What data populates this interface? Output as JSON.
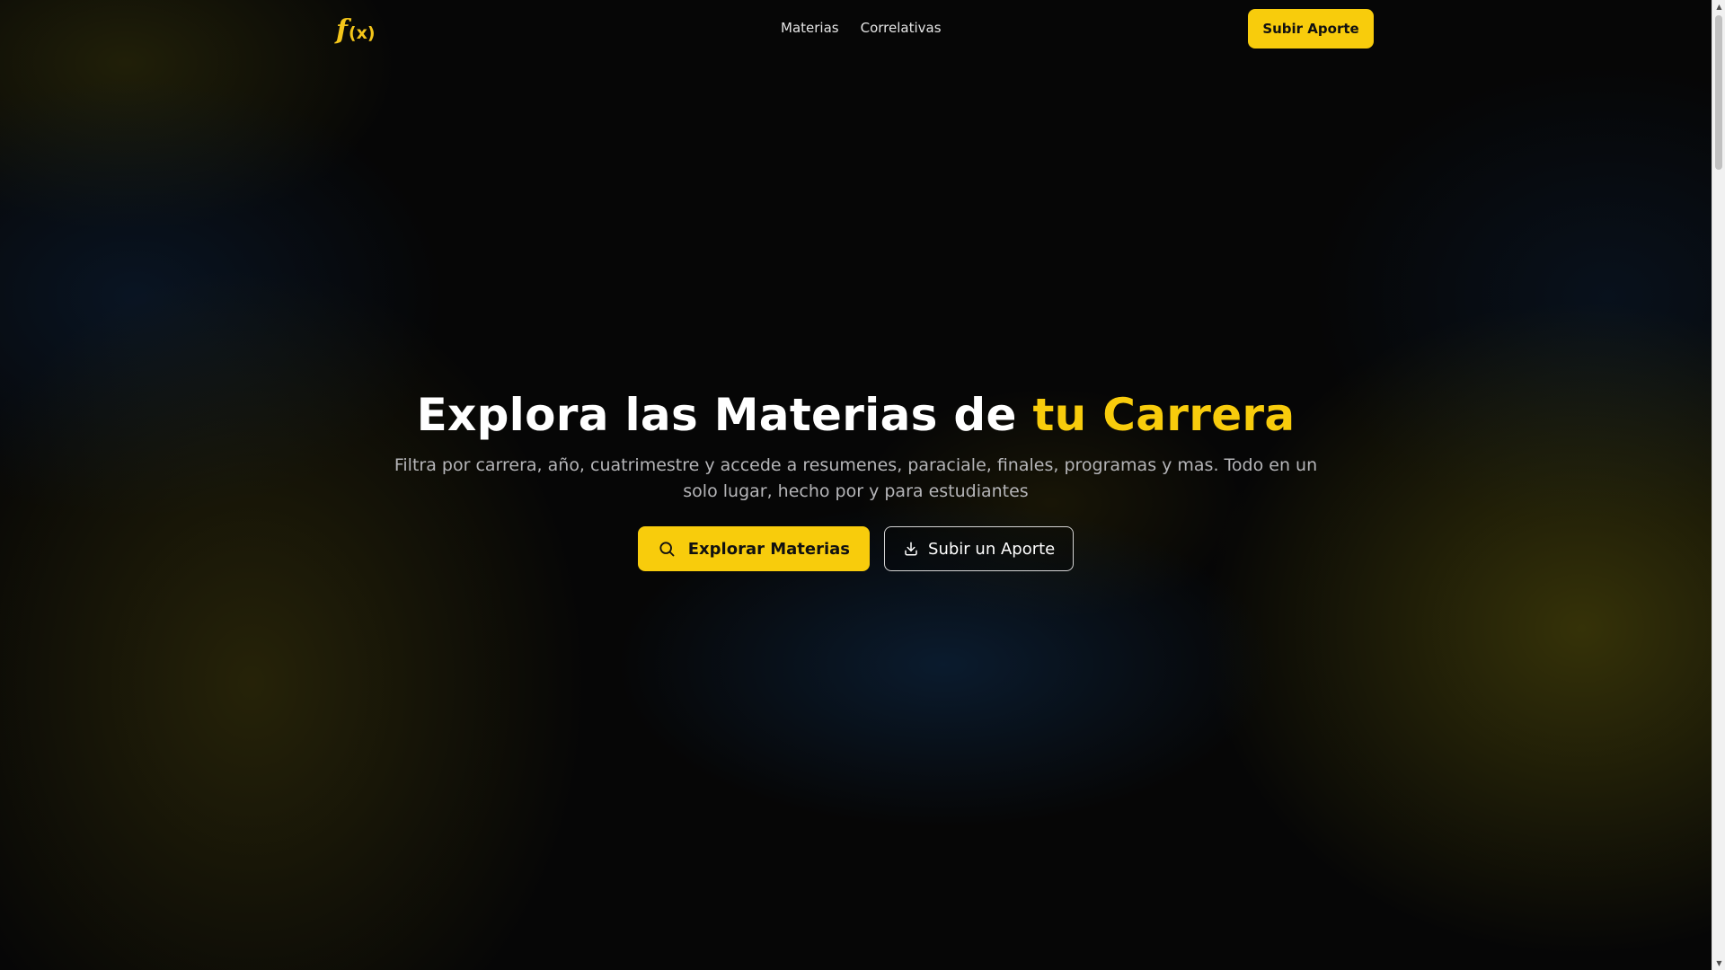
{
  "brand": {
    "logo_f": "f",
    "logo_x": "(x)",
    "accent_color": "#f8cc0c"
  },
  "nav": {
    "links": [
      {
        "label": "Materias"
      },
      {
        "label": "Correlativas"
      }
    ],
    "cta_label": "Subir Aporte"
  },
  "hero": {
    "title_main": "Explora las Materias de ",
    "title_accent": "tu Carrera",
    "subtitle": "Filtra por carrera, año, cuatrimestre y accede a resumenes, paraciale, finales, programas y mas. Todo en un solo lugar, hecho por y para estudiantes",
    "primary_button": {
      "label": "Explorar Materias",
      "icon": "search-icon"
    },
    "secondary_button": {
      "label": "Subir un Aporte",
      "icon": "download-icon"
    }
  },
  "scrollbar": {
    "up_arrow": "▲",
    "down_arrow": "▼"
  }
}
